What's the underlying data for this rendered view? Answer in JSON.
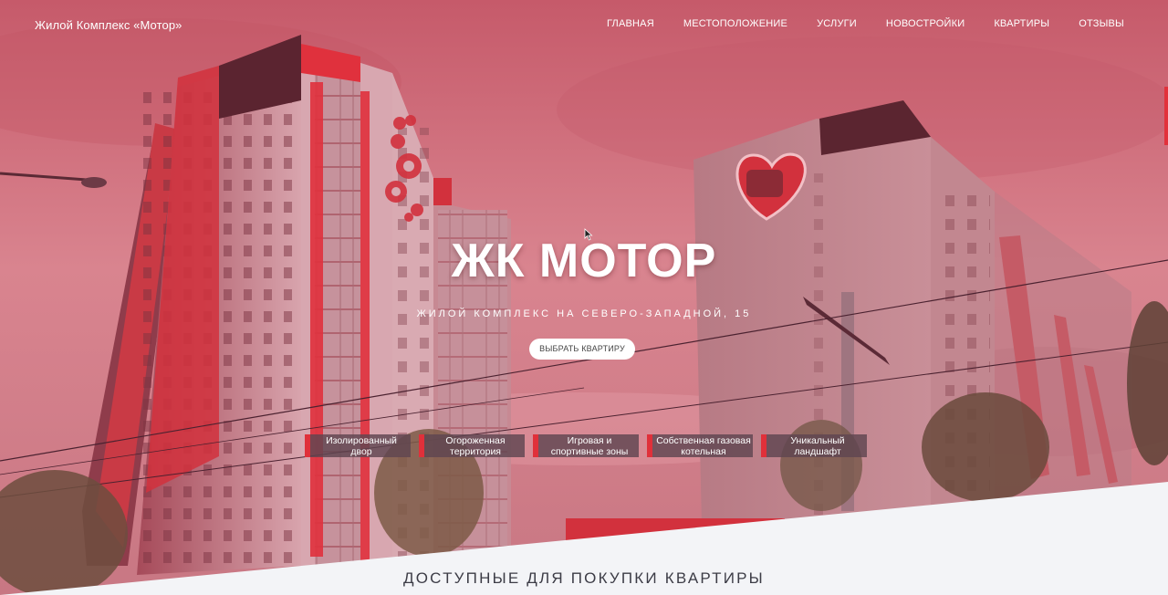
{
  "brand": "Жилой Комплекс «Мотор»",
  "nav": {
    "items": [
      {
        "label": "ГЛАВНАЯ",
        "name": "nav-home"
      },
      {
        "label": "МЕСТОПОЛОЖЕНИЕ",
        "name": "nav-location"
      },
      {
        "label": "УСЛУГИ",
        "name": "nav-services"
      },
      {
        "label": "НОВОСТРОЙКИ",
        "name": "nav-new-buildings"
      },
      {
        "label": "КВАРТИРЫ",
        "name": "nav-apartments"
      },
      {
        "label": "ОТЗЫВЫ",
        "name": "nav-reviews"
      }
    ]
  },
  "hero": {
    "title": "ЖК МОТОР",
    "subtitle": "ЖИЛОЙ КОМПЛЕКС НА СЕВЕРО-ЗАПАДНОЙ, 15",
    "cta_label": "ВЫБРАТЬ КВАРТИРУ"
  },
  "features": [
    {
      "line1": "Изолированный",
      "line2": "двор"
    },
    {
      "line1": "Огороженная",
      "line2": "территория"
    },
    {
      "line1": "Игровая и",
      "line2": "спортивные зоны"
    },
    {
      "line1": "Собственная газовая",
      "line2": "котельная"
    },
    {
      "line1": "Уникальный",
      "line2": "ландшафт"
    }
  ],
  "section": {
    "title": "ДОСТУПНЫЕ ДЛЯ ПОКУПКИ КВАРТИРЫ"
  },
  "colors": {
    "accent": "#e0303a",
    "overlay": "#d9707c",
    "section_bg": "#f3f4f7"
  }
}
